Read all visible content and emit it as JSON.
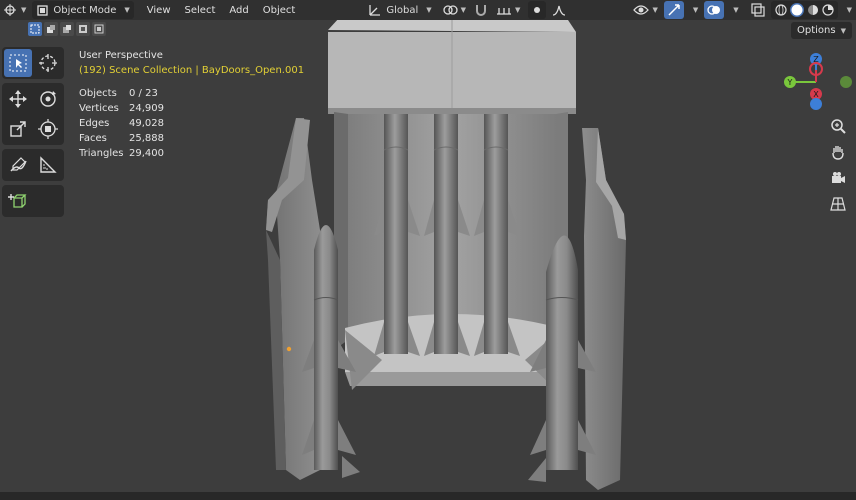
{
  "header": {
    "mode_label": "Object Mode",
    "menu": [
      "View",
      "Select",
      "Add",
      "Object"
    ],
    "transform_orientation": "Global"
  },
  "options_label": "Options",
  "viewport": {
    "perspective": "User Perspective",
    "collection": "(192) Scene Collection | BayDoors_Open.001"
  },
  "stats": [
    {
      "label": "Objects",
      "value": "0 / 23"
    },
    {
      "label": "Vertices",
      "value": "24,909"
    },
    {
      "label": "Edges",
      "value": "49,028"
    },
    {
      "label": "Faces",
      "value": "25,888"
    },
    {
      "label": "Triangles",
      "value": "29,400"
    }
  ],
  "gizmo": {
    "y_label": "Y",
    "z_label": "Z",
    "x_label": "X"
  },
  "colors": {
    "accent": "#4772b3",
    "scene_text": "#e2d035",
    "x_axis": "#d63a4c",
    "y_axis": "#7ac73c",
    "z_axis": "#3d7fd8"
  }
}
